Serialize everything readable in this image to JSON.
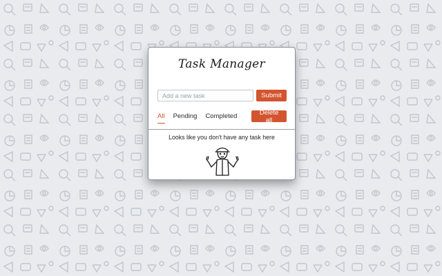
{
  "app": {
    "title": "Task Manager"
  },
  "task_form": {
    "input_placeholder": "Add a new task",
    "input_value": "",
    "submit_label": "Submit"
  },
  "filters": {
    "items": [
      {
        "label": "All",
        "active": true
      },
      {
        "label": "Pending",
        "active": false
      },
      {
        "label": "Completed",
        "active": false
      }
    ],
    "delete_all_label": "Delete all"
  },
  "empty_state": {
    "message": "Looks like you don't have any task here",
    "illustration_icon": "shrugging-person-icon"
  },
  "colors": {
    "accent": "#d2552f",
    "background": "#e9ebee",
    "pattern": "#bfc4cb"
  }
}
